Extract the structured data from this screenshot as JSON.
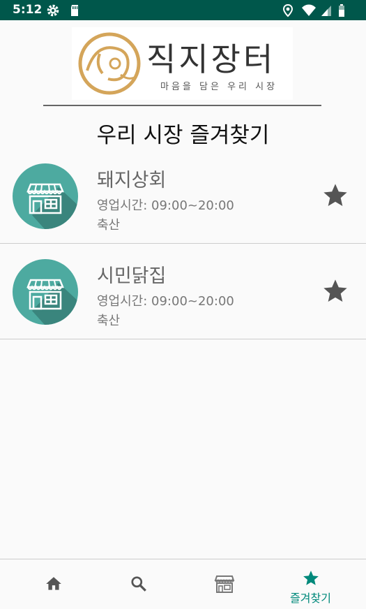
{
  "status_bar": {
    "time": "5:12",
    "icons_left": [
      "gear-icon",
      "sd-card-icon"
    ],
    "icons_right": [
      "location-icon",
      "wifi-icon",
      "signal-icon",
      "battery-icon"
    ]
  },
  "logo": {
    "title": "직지장터",
    "subtitle": "마음을 담은 우리 시장",
    "colors": {
      "ring": "#d4a55a",
      "text": "#333333"
    }
  },
  "page_title": "우리 시장 즐겨찾기",
  "stores": [
    {
      "name": "돼지상회",
      "hours": "영업시간: 09:00~20:00",
      "category": "축산",
      "favorite": true,
      "icon": "storefront-icon"
    },
    {
      "name": "시민닭집",
      "hours": "영업시간: 09:00~20:00",
      "category": "축산",
      "favorite": true,
      "icon": "storefront-icon"
    }
  ],
  "bottom_nav": {
    "items": [
      {
        "icon": "home-icon",
        "label": ""
      },
      {
        "icon": "search-icon",
        "label": ""
      },
      {
        "icon": "store-icon",
        "label": ""
      },
      {
        "icon": "star-icon",
        "label": "즐겨찾기",
        "active": true
      }
    ]
  },
  "colors": {
    "status_bar": "#00574b",
    "accent": "#00897b",
    "avatar": "#4daaa0",
    "star": "#555555"
  }
}
